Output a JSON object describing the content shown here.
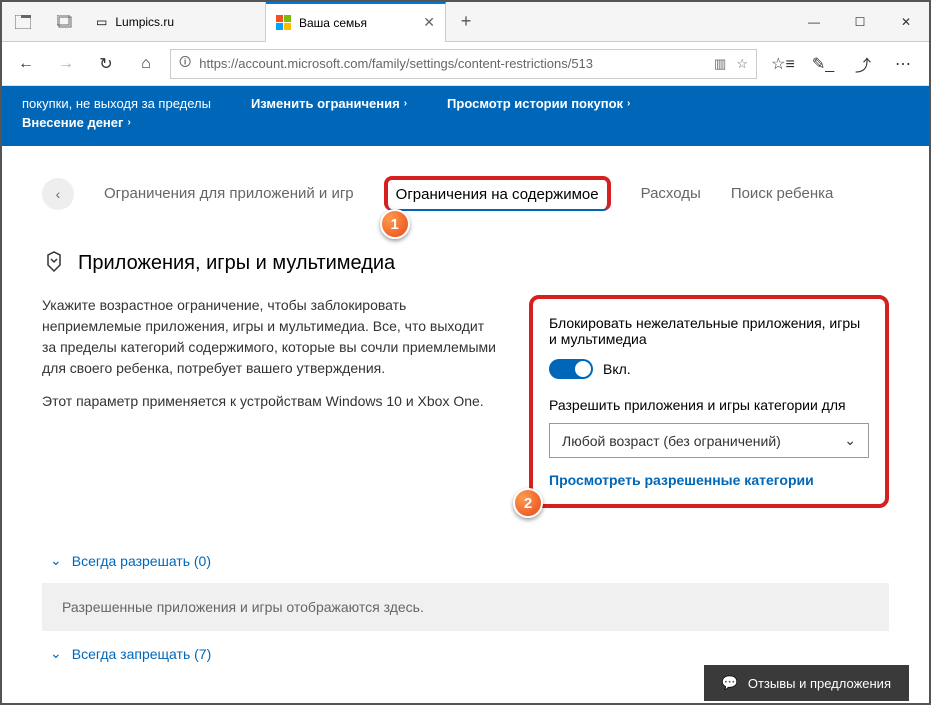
{
  "tabs": {
    "inactive": "Lumpics.ru",
    "active": "Ваша семья"
  },
  "url": "https://account.microsoft.com/family/settings/content-restrictions/513",
  "banner": {
    "line1": "покупки, не выходя за пределы",
    "line2": "Внесение денег",
    "mid": "Изменить ограничения",
    "right": "Просмотр истории покупок"
  },
  "nav": {
    "apps": "Ограничения для приложений и игр",
    "content": "Ограничения на содержимое",
    "spending": "Расходы",
    "find": "Поиск ребенка"
  },
  "section": {
    "title": "Приложения, игры и мультимедиа",
    "desc1": "Укажите возрастное ограничение, чтобы заблокировать неприемлемые приложения, игры и мультимедиа. Все, что выходит за пределы категорий содержимого, которые вы сочли приемлемыми для своего ребенка, потребует вашего утверждения.",
    "desc2": "Этот параметр применяется к устройствам Windows 10 и Xbox One."
  },
  "settings": {
    "block_label": "Блокировать нежелательные приложения, игры и мультимедиа",
    "toggle_state": "Вкл.",
    "allow_label": "Разрешить приложения и игры категории для",
    "select_value": "Любой возраст (без ограничений)",
    "view_link": "Просмотреть разрешенные категории"
  },
  "expand": {
    "allow": "Всегда разрешать (0)",
    "empty": "Разрешенные приложения и игры отображаются здесь.",
    "block": "Всегда запрещать (7)"
  },
  "feedback": "Отзывы и предложения",
  "callouts": {
    "one": "1",
    "two": "2"
  }
}
